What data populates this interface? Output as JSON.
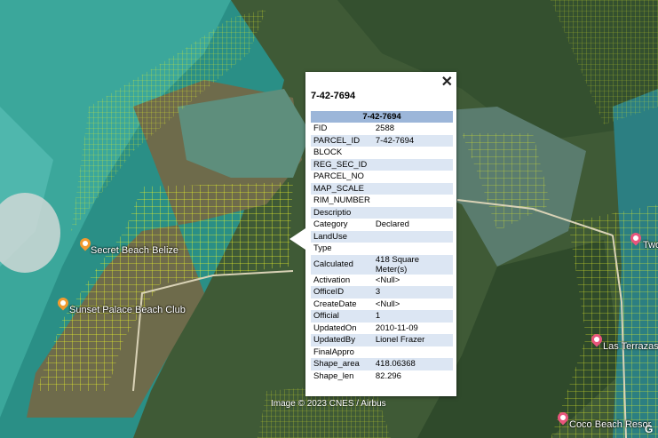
{
  "places": [
    {
      "label": "Secret Beach Belize",
      "color": "#f29a2e"
    },
    {
      "label": "Sunset Palace Beach Club",
      "color": "#f29a2e"
    },
    {
      "label": "Two",
      "color": "#e8557c"
    },
    {
      "label": "Las Terrazas",
      "color": "#e8557c"
    },
    {
      "label": "Coco Beach Resor",
      "color": "#e8557c"
    }
  ],
  "attribution": "Image © 2023 CNES / Airbus",
  "corner_logo": "G",
  "popup": {
    "title": "7-42-7694",
    "header": "7-42-7694",
    "close_icon": "close-icon",
    "rows": [
      {
        "k": "FID",
        "v": "2588"
      },
      {
        "k": "PARCEL_ID",
        "v": "7-42-7694"
      },
      {
        "k": "BLOCK",
        "v": ""
      },
      {
        "k": "REG_SEC_ID",
        "v": ""
      },
      {
        "k": "PARCEL_NO",
        "v": ""
      },
      {
        "k": "MAP_SCALE",
        "v": ""
      },
      {
        "k": "RIM_NUMBER",
        "v": ""
      },
      {
        "k": "Descriptio",
        "v": ""
      },
      {
        "k": "Category",
        "v": "Declared"
      },
      {
        "k": "LandUse",
        "v": ""
      },
      {
        "k": "Type",
        "v": ""
      },
      {
        "k": "Calculated",
        "v": "418 Square Meter(s)"
      },
      {
        "k": "Activation",
        "v": "<Null>"
      },
      {
        "k": "OfficeID",
        "v": "3"
      },
      {
        "k": "CreateDate",
        "v": "<Null>"
      },
      {
        "k": "Official",
        "v": "1"
      },
      {
        "k": "UpdatedOn",
        "v": "2010-11-09"
      },
      {
        "k": "UpdatedBy",
        "v": "Lionel Frazer"
      },
      {
        "k": "FinalAppro",
        "v": ""
      },
      {
        "k": "Shape_area",
        "v": "418.06368"
      },
      {
        "k": "Shape_len",
        "v": "82.296"
      }
    ]
  }
}
